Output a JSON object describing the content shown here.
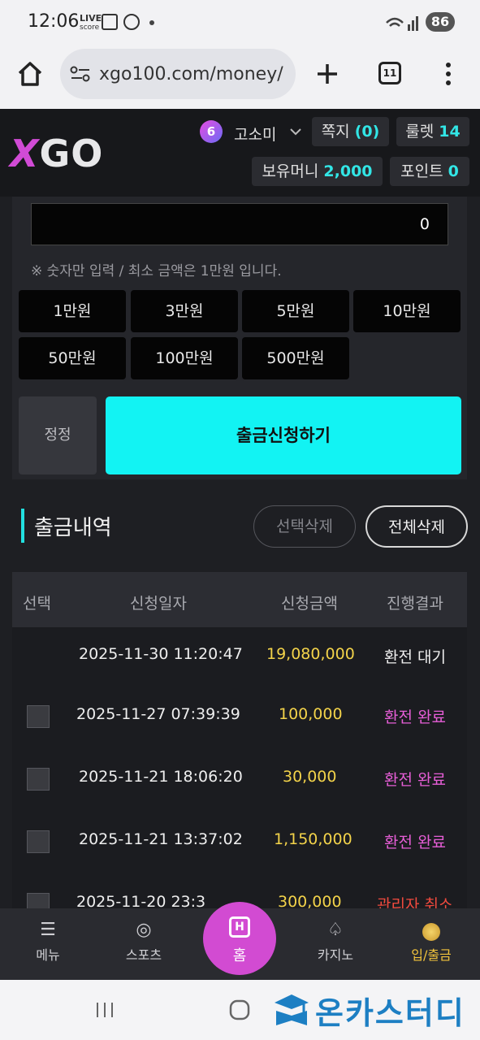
{
  "status_bar": {
    "time": "12:06",
    "live": "LIVE",
    "score": "score",
    "battery": "86"
  },
  "browser": {
    "url": "xgo100.com/money/",
    "tab_count": "11"
  },
  "site": {
    "logo_x": "X",
    "logo_go": "GO",
    "level": "6",
    "username": "고소미",
    "message_label": "쪽지",
    "message_count": "(0)",
    "roulette_label": "룰렛",
    "roulette_count": "14",
    "money_label": "보유머니",
    "money_value": "2,000",
    "point_label": "포인트",
    "point_value": "0"
  },
  "withdraw": {
    "amount_value": "0",
    "note": "※ 숫자만 입력 / 최소 금액은 1만원 입니다.",
    "quick_amounts": [
      "1만원",
      "3만원",
      "5만원",
      "10만원",
      "50만원",
      "100만원",
      "500만원"
    ],
    "reset_label": "정정",
    "submit_label": "출금신청하기"
  },
  "history": {
    "title": "출금내역",
    "delete_selected": "선택삭제",
    "delete_all": "전체삭제",
    "columns": [
      "선택",
      "신청일자",
      "신청금액",
      "진행결과"
    ],
    "rows": [
      {
        "date": "2025-11-30 11:20:47",
        "amount": "19,080,000",
        "status": "환전 대기",
        "status_type": "wait",
        "checkbox": false
      },
      {
        "date": "2025-11-27 07:39:39",
        "amount": "100,000",
        "status": "환전 완료",
        "status_type": "done",
        "checkbox": true
      },
      {
        "date": "2025-11-21 18:06:20",
        "amount": "30,000",
        "status": "환전 완료",
        "status_type": "done",
        "checkbox": true
      },
      {
        "date": "2025-11-21 13:37:02",
        "amount": "1,150,000",
        "status": "환전 완료",
        "status_type": "done",
        "checkbox": true
      },
      {
        "date": "2025-11-20 23:3",
        "amount": "300,000",
        "status": "관리자 취소",
        "status_type": "cancel",
        "checkbox": true
      }
    ]
  },
  "bottom_nav": {
    "menu": "메뉴",
    "sports": "스포츠",
    "home": "홈",
    "casino": "카지노",
    "deposit": "입/출금"
  },
  "watermark": "온카스터디",
  "colors": {
    "accent_cyan": "#12f3f3",
    "brand_pink": "#d24bd2",
    "amount_yellow": "#f3d34a",
    "done_pink": "#e75ed7",
    "cancel_red": "#f04a3e"
  }
}
